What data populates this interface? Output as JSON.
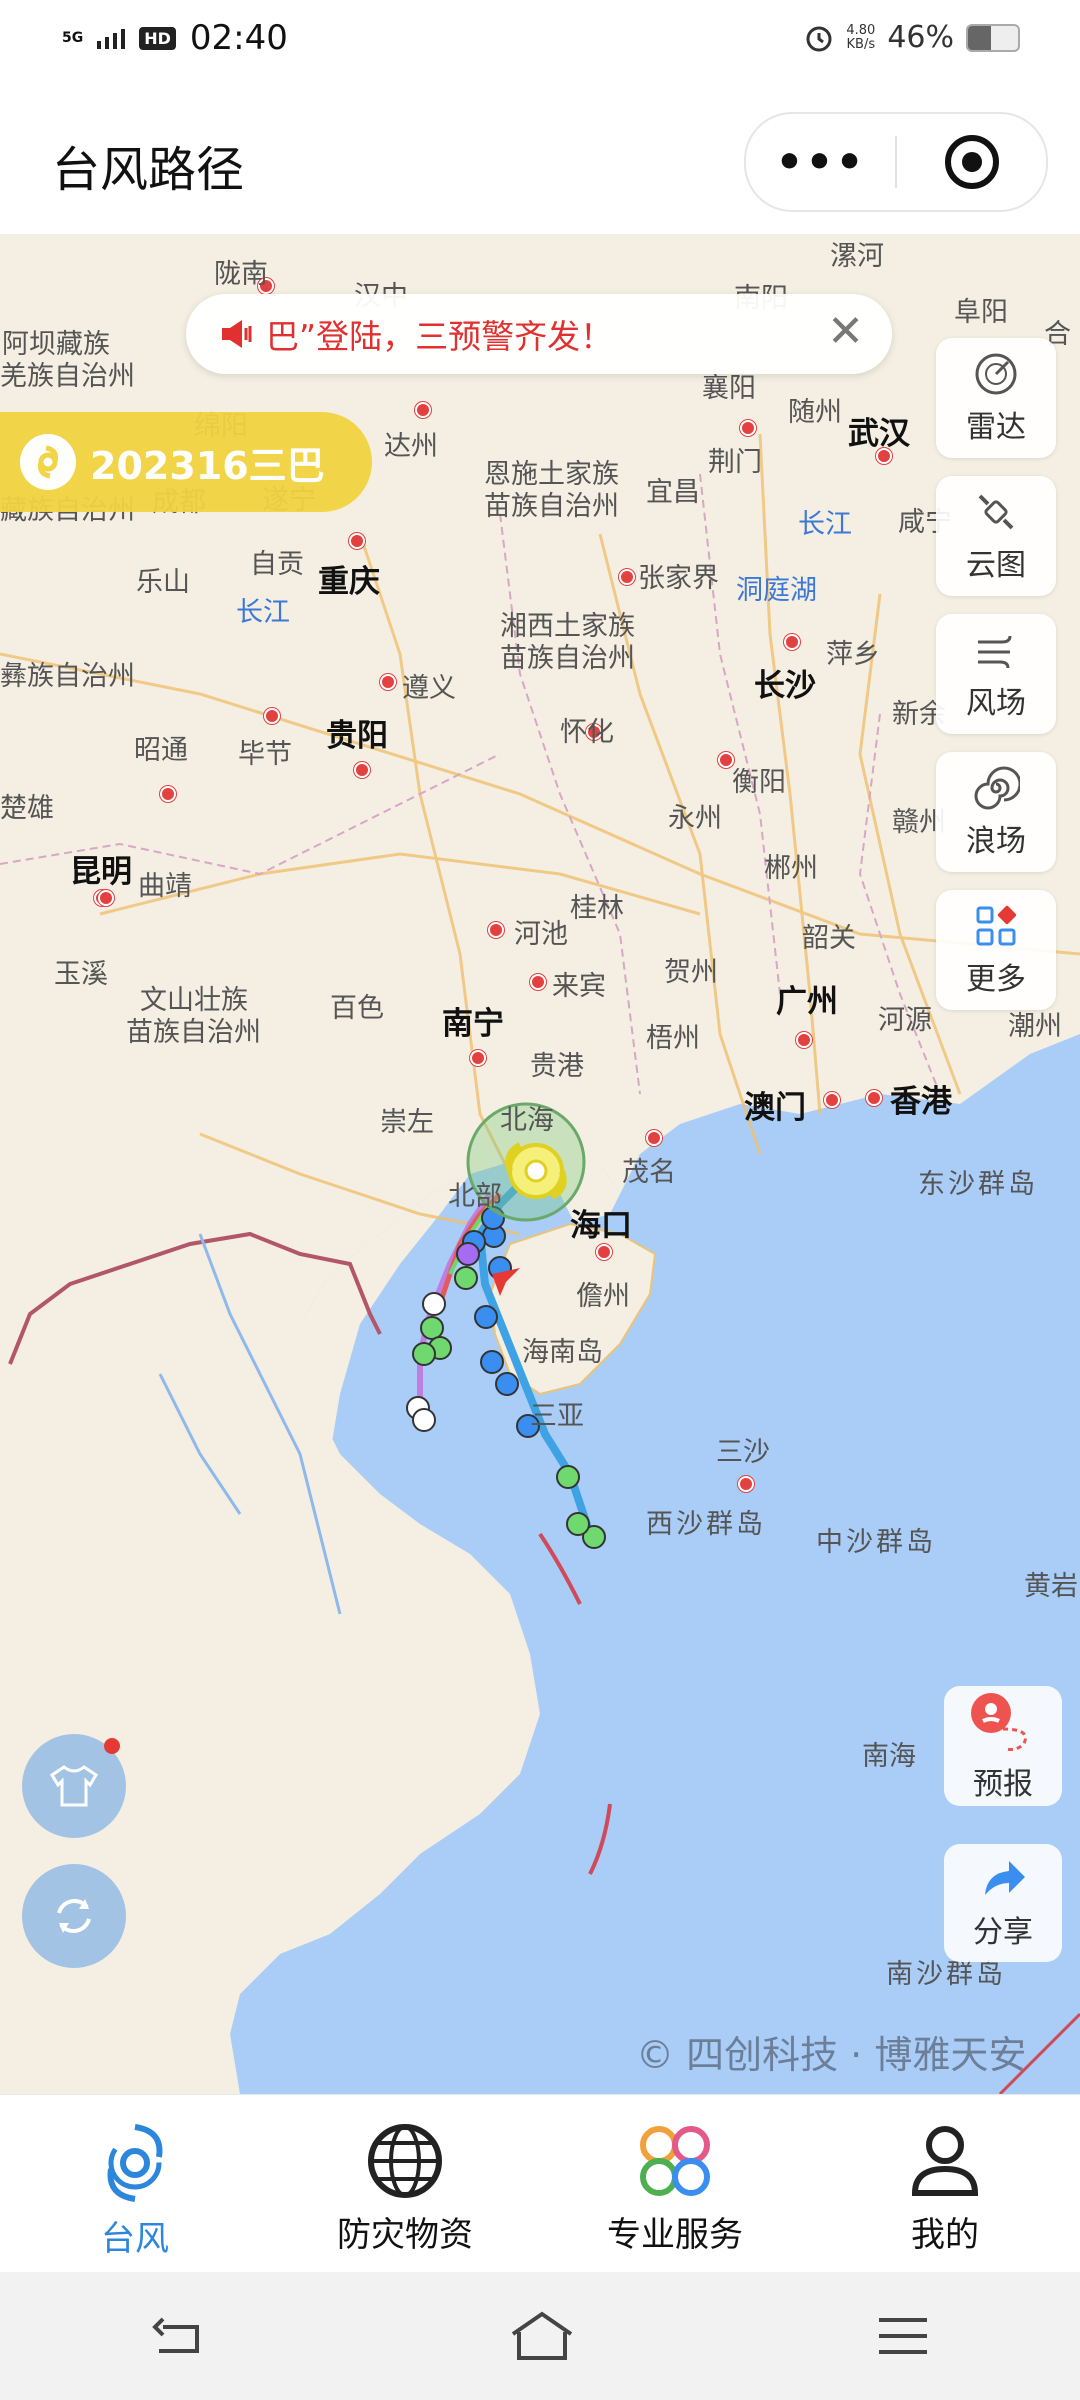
{
  "status_bar": {
    "network": "5G",
    "hd": "HD",
    "time": "02:40",
    "net_speed_value": "4.80",
    "net_speed_unit": "KB/s",
    "battery": "46%"
  },
  "header": {
    "title": "台风路径",
    "more_button": "•••",
    "close_icon": "target-icon"
  },
  "map": {
    "notice": "巴”登陆，三预警齐发！",
    "typhoon_badge": "202316三巴",
    "copyright": "© 四创科技 · 博雅天安",
    "places": {
      "longnan": "陇南",
      "hanzhong": "汉中",
      "nanyang": "南阳",
      "luohe": "漯河",
      "fuyang": "阜阳",
      "aba": "阿坝藏族",
      "qiang": "羌族自治州",
      "xiangyang": "襄阳",
      "suizhou": "随州",
      "he": "合",
      "mianyang": "绵阳",
      "dazhou": "达州",
      "wuhan": "武汉",
      "enshi1": "恩施土家族",
      "enshi2": "苗族自治州",
      "jingmen": "荆门",
      "tibet": "藏族自治州",
      "chengdu": "成都",
      "suining": "遂宁",
      "yichang": "宜昌",
      "changjiang1": "长江",
      "xianning": "咸宁",
      "zigong": "自贡",
      "leshan": "乐山",
      "chongqing": "重庆",
      "zhangjiajie": "张家界",
      "dongtinghu": "洞庭湖",
      "changjiang2": "长江",
      "xiangxi1": "湘西土家族",
      "xiangxi2": "苗族自治州",
      "pingxiang": "萍乡",
      "yi": "彝族自治州",
      "zunyi": "遵义",
      "changsha": "长沙",
      "xinyu": "新余",
      "zhaotong": "昭通",
      "bijie": "毕节",
      "guiyang": "贵阳",
      "huaihua": "怀化",
      "chuxiong": "楚雄",
      "hengyang": "衡阳",
      "yongzhou": "永州",
      "kunming": "昆明",
      "qujing": "曲靖",
      "ganzhou": "赣州",
      "guilin": "桂林",
      "chenzhou": "郴州",
      "yuxi": "玉溪",
      "hechi": "河池",
      "shaoguan": "韶关",
      "wenshan1": "文山壮族",
      "wenshan2": "苗族自治州",
      "laibin": "来宾",
      "hezhou": "贺州",
      "guangzhou": "广州",
      "baise": "百色",
      "nanning": "南宁",
      "guigang": "贵港",
      "wuzhou": "梧州",
      "heyuan": "河源",
      "chaozhou": "潮州",
      "chongzuo": "崇左",
      "beihai": "北海",
      "macau": "澳门",
      "hongkong": "香港",
      "maoming": "茂名",
      "dongsha": "东沙群岛",
      "beibu": "北部",
      "haikou": "海口",
      "danzhou": "儋州",
      "hainan": "海南岛",
      "sanya": "三亚",
      "sansha": "三沙",
      "xisha": "西沙群岛",
      "zhongsha": "中沙群岛",
      "huangyan": "黄岩",
      "nanhai": "南海",
      "nansha": "南沙群岛"
    },
    "tools": [
      {
        "label": "雷达",
        "icon": "radar-icon"
      },
      {
        "label": "云图",
        "icon": "satellite-icon"
      },
      {
        "label": "风场",
        "icon": "wind-icon"
      },
      {
        "label": "浪场",
        "icon": "wave-icon"
      },
      {
        "label": "更多",
        "icon": "grid-icon"
      }
    ],
    "forecast_label": "预报",
    "share_label": "分享"
  },
  "tabbar": {
    "tabs": [
      {
        "label": "台风",
        "icon": "typhoon-icon",
        "active": true
      },
      {
        "label": "防灾物资",
        "icon": "globe-icon",
        "active": false
      },
      {
        "label": "专业服务",
        "icon": "flower-icon",
        "active": false
      },
      {
        "label": "我的",
        "icon": "person-icon",
        "active": false
      }
    ]
  },
  "colors": {
    "accent": "#2c86dc",
    "sea": "#a9cdf7",
    "land": "#f4efe2",
    "badge": "#f2d341",
    "notice_text": "#e03030"
  }
}
